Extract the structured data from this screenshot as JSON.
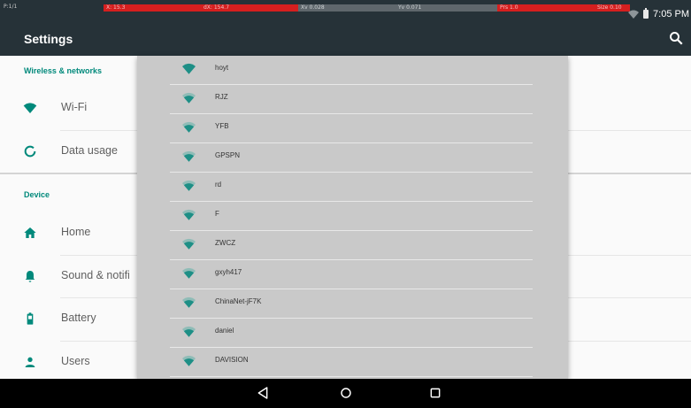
{
  "status_bar": {
    "left_text": "P:1/1",
    "diagnostics": [
      "X: 15.3",
      "dX: 154.7",
      "Xv 0.028",
      "Yv 0.071",
      "Prs 1.0",
      "Size 0.10"
    ],
    "time": "7:05 PM",
    "icons": [
      "wifi-icon",
      "battery-icon"
    ]
  },
  "app_bar": {
    "title": "Settings",
    "search_icon": "search-icon"
  },
  "settings": {
    "sections": [
      {
        "header": "Wireless & networks",
        "items": [
          {
            "label": "Wi-Fi",
            "icon": "wifi-icon"
          },
          {
            "label": "Data usage",
            "icon": "data-usage-icon"
          }
        ]
      },
      {
        "header": "Device",
        "items": [
          {
            "label": "Home",
            "icon": "home-icon"
          },
          {
            "label": "Sound & notifi",
            "icon": "bell-icon"
          },
          {
            "label": "Battery",
            "icon": "battery-icon"
          },
          {
            "label": "Users",
            "icon": "user-icon"
          }
        ]
      }
    ]
  },
  "wifi_list": {
    "networks": [
      {
        "ssid": "hoyt",
        "strength": "full"
      },
      {
        "ssid": "RJZ",
        "strength": "partial"
      },
      {
        "ssid": "YFB",
        "strength": "partial"
      },
      {
        "ssid": "GPSPN",
        "strength": "partial"
      },
      {
        "ssid": "rd",
        "strength": "partial"
      },
      {
        "ssid": "F",
        "strength": "partial"
      },
      {
        "ssid": "ZWCZ",
        "strength": "partial"
      },
      {
        "ssid": "gxyh417",
        "strength": "partial"
      },
      {
        "ssid": "ChinaNet-jF7K",
        "strength": "partial"
      },
      {
        "ssid": "daniel",
        "strength": "partial"
      },
      {
        "ssid": "DAVISION",
        "strength": "partial"
      }
    ]
  },
  "nav_bar": {
    "buttons": [
      "back-icon",
      "home-icon",
      "recents-icon"
    ]
  },
  "colors": {
    "accent": "#00897b",
    "wifi_icon": "#1e8f86",
    "app_bar": "#263238",
    "panel": "#c9c9c9"
  }
}
